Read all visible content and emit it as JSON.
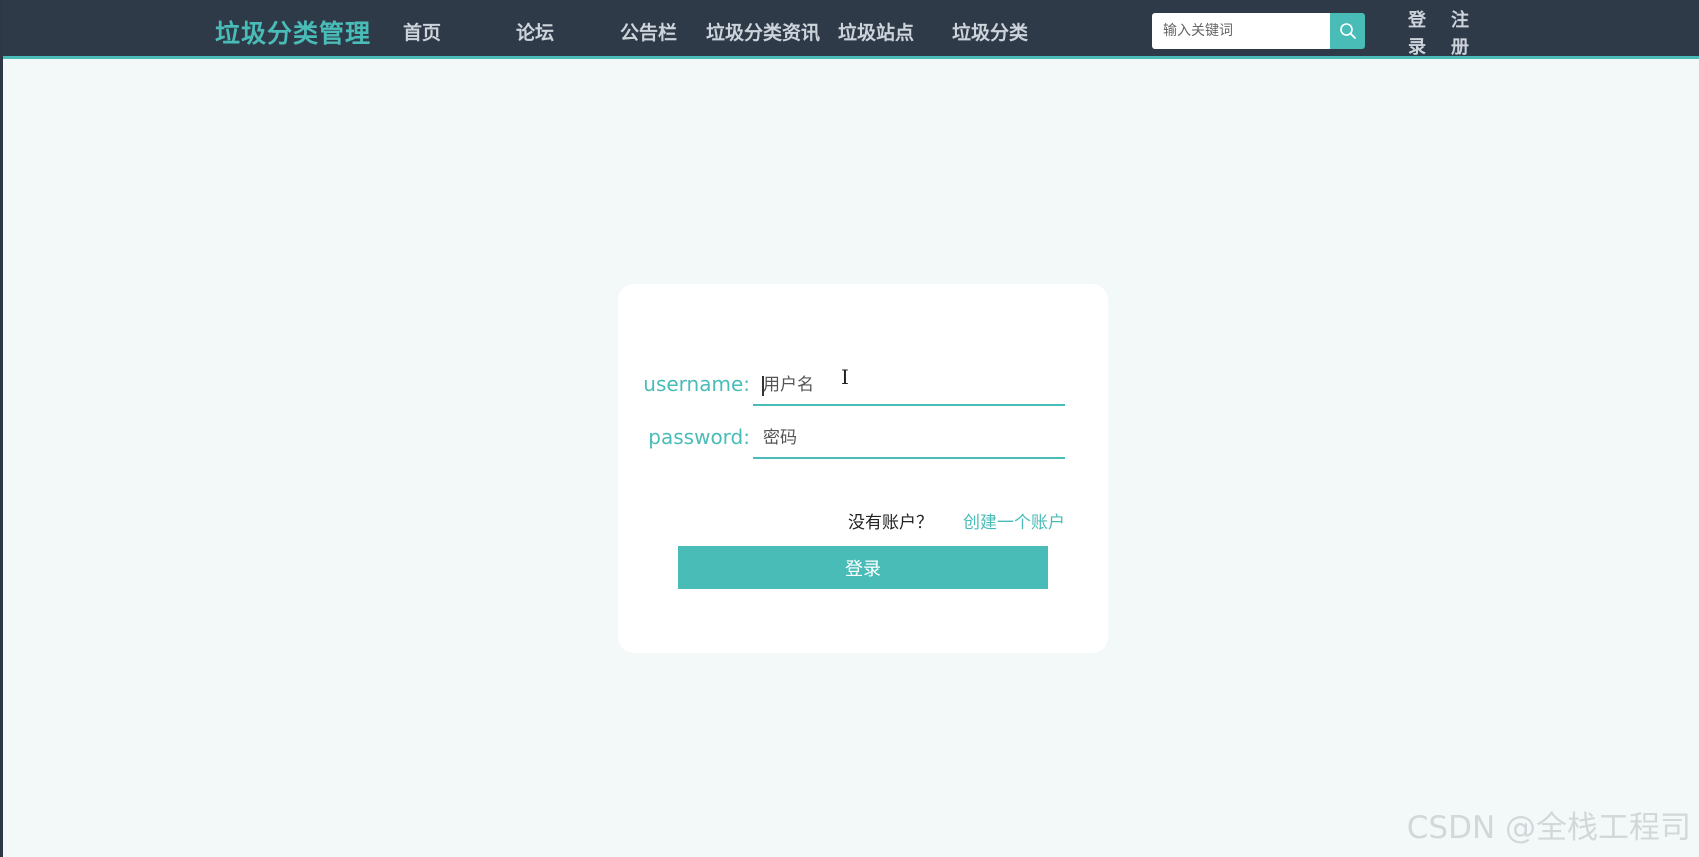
{
  "header": {
    "logo": "垃圾分类管理",
    "nav": [
      {
        "label": "首页"
      },
      {
        "label": "论坛"
      },
      {
        "label": "公告栏"
      },
      {
        "label": "垃圾分类资讯"
      },
      {
        "label": "垃圾站点"
      },
      {
        "label": "垃圾分类"
      }
    ],
    "search": {
      "placeholder": "输入关键词",
      "icon": "search-icon"
    },
    "login_label": "登录",
    "register_label": "注册"
  },
  "login_form": {
    "username": {
      "label": "username:",
      "placeholder": "用户名",
      "value": ""
    },
    "password": {
      "label": "password:",
      "placeholder": "密码",
      "value": ""
    },
    "no_account_text": "没有账户？",
    "create_account_link": "创建一个账户",
    "submit_label": "登录"
  },
  "watermark": "CSDN @全栈工程司",
  "colors": {
    "accent": "#4abcb8",
    "header_bg": "#2f3a49",
    "page_bg": "#f3f8f8"
  }
}
